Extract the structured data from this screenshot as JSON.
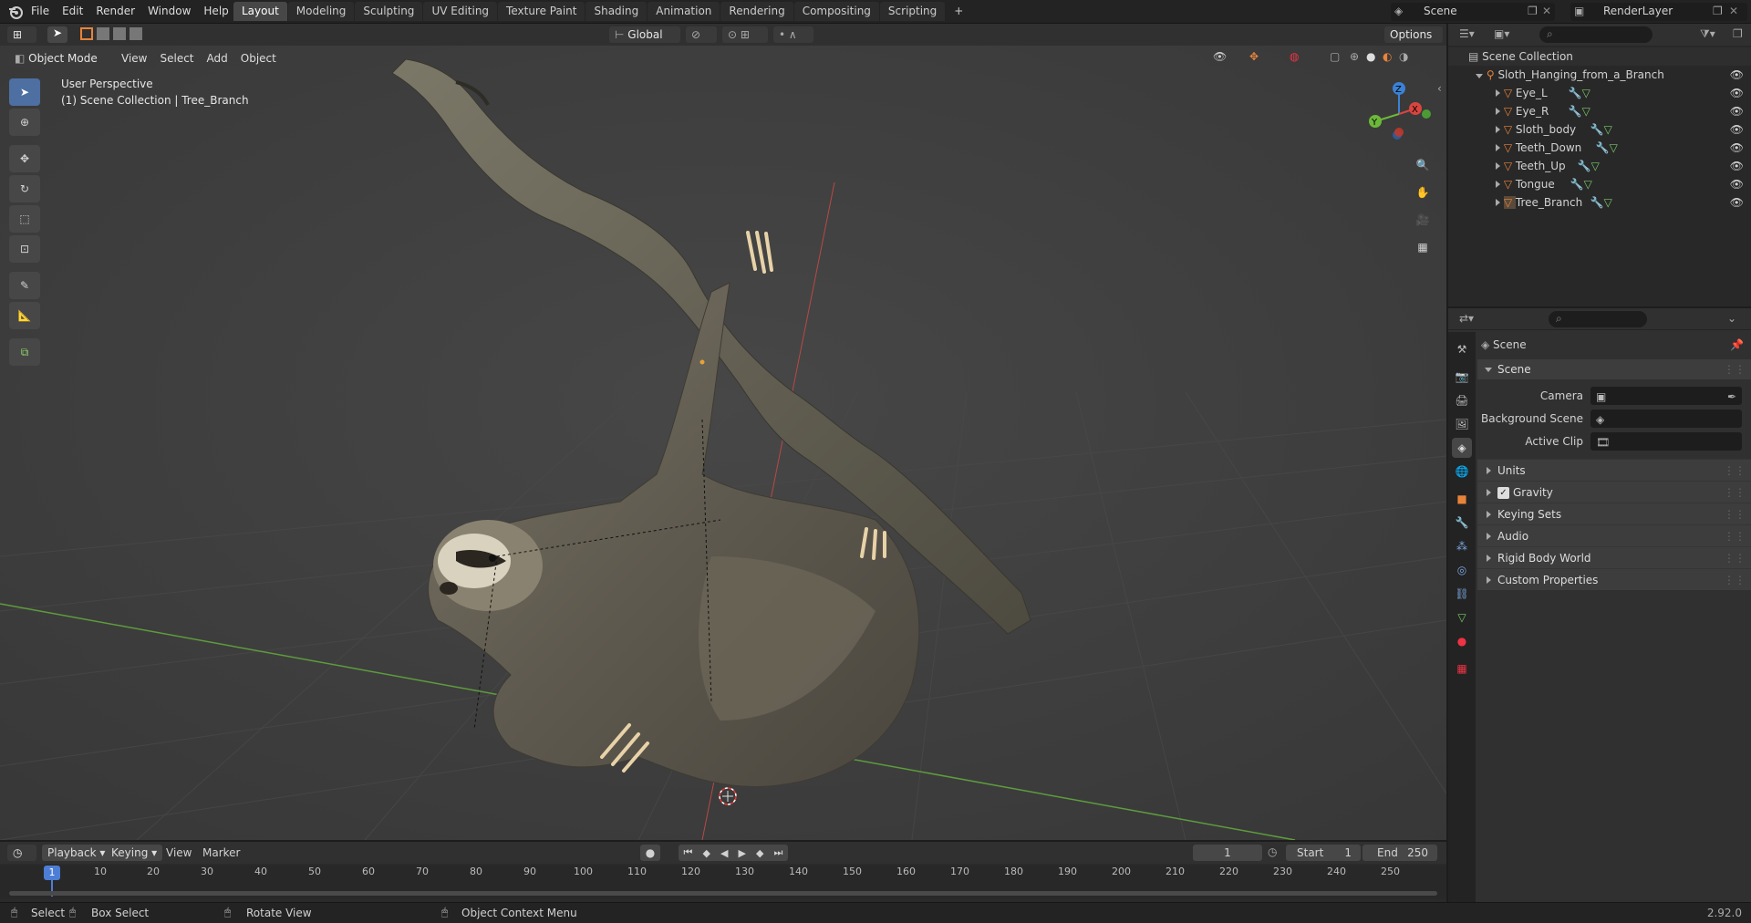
{
  "topbar": {
    "menus": [
      "File",
      "Edit",
      "Render",
      "Window",
      "Help"
    ],
    "workspaces": [
      "Layout",
      "Modeling",
      "Sculpting",
      "UV Editing",
      "Texture Paint",
      "Shading",
      "Animation",
      "Rendering",
      "Compositing",
      "Scripting"
    ],
    "active_workspace": "Layout",
    "add_tab": "+",
    "scene_name": "Scene",
    "view_layer": "RenderLayer"
  },
  "viewport_header": {
    "mode": "Object Mode",
    "menus": [
      "View",
      "Select",
      "Add",
      "Object"
    ],
    "orientation": "Global",
    "options": "Options"
  },
  "viewport": {
    "perspective": "User Perspective",
    "context": "(1) Scene Collection | Tree_Branch",
    "gizmo_axes": {
      "z": "Z",
      "y": "Y",
      "x": "X"
    }
  },
  "outliner": {
    "root": "Scene Collection",
    "collection": "Sloth_Hanging_from_a_Branch",
    "objects": [
      "Eye_L",
      "Eye_R",
      "Sloth_body",
      "Teeth_Down",
      "Teeth_Up",
      "Tongue",
      "Tree_Branch"
    ]
  },
  "properties": {
    "context_title": "Scene",
    "panel_title": "Scene",
    "fields": [
      {
        "label": "Camera"
      },
      {
        "label": "Background Scene"
      },
      {
        "label": "Active Clip"
      }
    ],
    "subpanels": [
      "Units",
      "Gravity",
      "Keying Sets",
      "Audio",
      "Rigid Body World",
      "Custom Properties"
    ],
    "gravity_checked": true
  },
  "timeline": {
    "menus": [
      "Playback",
      "Keying",
      "View",
      "Marker"
    ],
    "current_frame": "1",
    "start_label": "Start",
    "start": "1",
    "end_label": "End",
    "end": "250",
    "ruler_marker": "1",
    "ruler": [
      "10",
      "20",
      "30",
      "40",
      "50",
      "60",
      "70",
      "80",
      "90",
      "100",
      "110",
      "120",
      "130",
      "140",
      "150",
      "160",
      "170",
      "180",
      "190",
      "200",
      "210",
      "220",
      "230",
      "240",
      "250"
    ]
  },
  "statusbar": {
    "select": "Select",
    "box_select": "Box Select",
    "rotate_view": "Rotate View",
    "context_menu": "Object Context Menu",
    "version": "2.92.0"
  },
  "colors": {
    "accent": "#4d6fa2",
    "object_icon": "#e8833a",
    "x_axis": "#d9453f",
    "y_axis": "#6cb83a",
    "z_axis": "#3b82d6"
  }
}
